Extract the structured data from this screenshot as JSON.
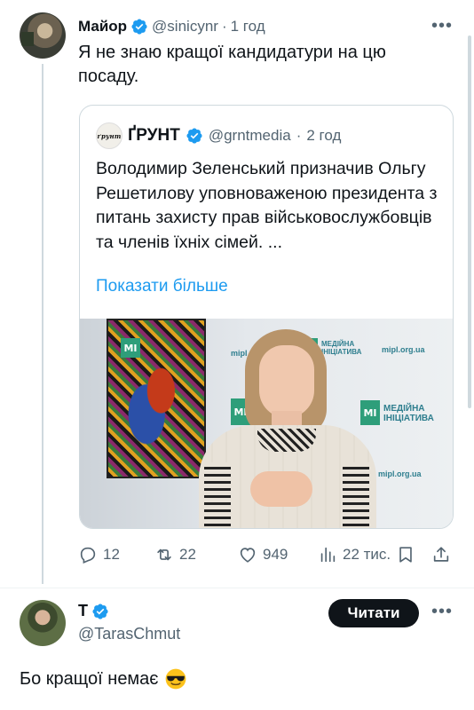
{
  "tweet1": {
    "author_name": "Майор",
    "handle": "@sinicynr",
    "separator": "·",
    "time": "1 год",
    "text": "Я не знаю кращої кандидатури на цю посаду.",
    "more_glyph": "•••",
    "quote": {
      "author_name": "ҐРУНТ",
      "handle": "@grntmedia",
      "separator": "·",
      "time": "2 год",
      "avatar_label": "ґрунт",
      "text": "Володимир Зеленський призначив Ольгу Решетилову уповноваженою президента з питань захисту прав військовослужбовців та членів їхніх сімей. ...",
      "show_more": "Показати більше",
      "image": {
        "logo_letters": "MI",
        "wall_text": "МЕДІЙНА ІНІЦІАТИВА",
        "wall_url": "mipl.org.ua",
        "wall_url_partial": "mipl"
      }
    },
    "actions": {
      "replies": "12",
      "retweets": "22",
      "likes": "949",
      "views": "22 тис."
    }
  },
  "tweet2": {
    "author_name": "T",
    "handle": "@TarasChmut",
    "follow_label": "Читати",
    "more_glyph": "•••",
    "text": "Бо кращої немає"
  },
  "colors": {
    "verified_blue": "#1d9bf0",
    "link_blue": "#1d9bf0",
    "muted_text": "#536471",
    "border": "#cfd9de",
    "follow_bg": "#0f1419",
    "image_logo_green": "#2e9e7a"
  },
  "icons": [
    "verified-badge-icon",
    "more-icon",
    "reply-icon",
    "retweet-icon",
    "like-icon",
    "views-icon",
    "bookmark-icon",
    "share-icon",
    "sunglasses-emoji-icon"
  ]
}
